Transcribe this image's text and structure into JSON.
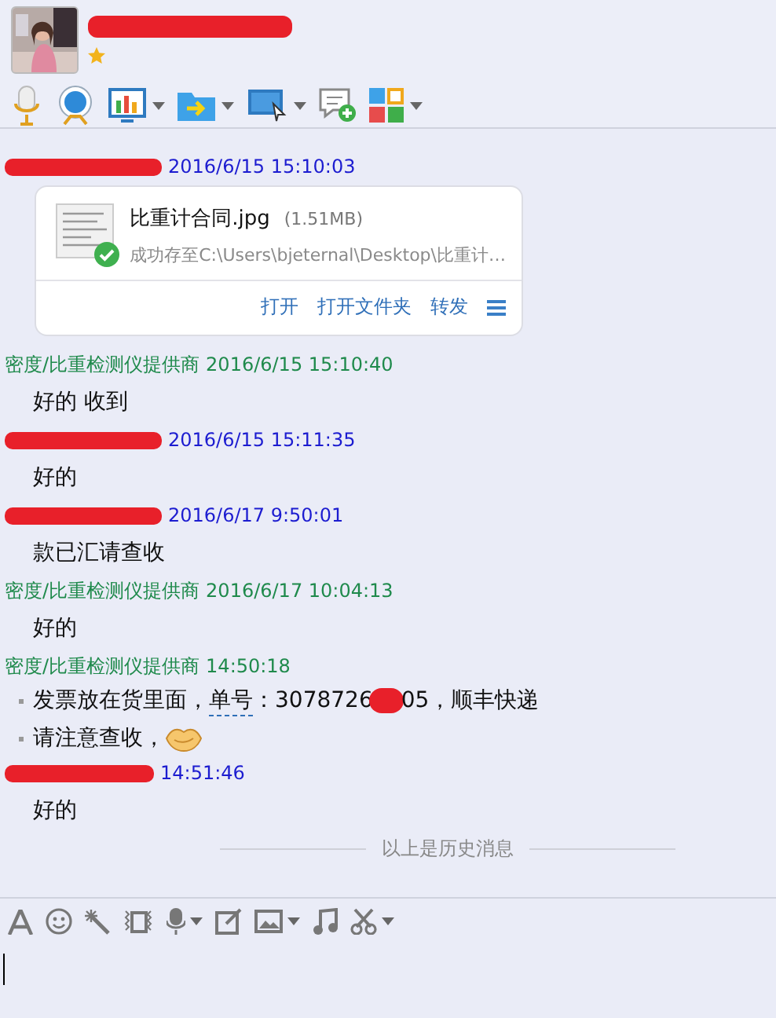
{
  "contact": {
    "name_redacted": true
  },
  "messages": [
    {
      "kind": "file",
      "sender": {
        "redacted": true
      },
      "time": "2016/6/15 15:10:03",
      "color": "#1c1cd0",
      "file": {
        "name": "比重计合同.jpg",
        "size": "(1.51MB)",
        "status": "成功存至C:\\Users\\bjeternal\\Desktop\\比重计…",
        "saved": true,
        "actions": [
          "打开",
          "打开文件夹",
          "转发"
        ]
      }
    },
    {
      "kind": "text",
      "sender": {
        "redacted": false,
        "name": "密度/比重检测仪提供商"
      },
      "time": "2016/6/15 15:10:40",
      "color": "#1f8a4c",
      "text": "好的 收到"
    },
    {
      "kind": "text",
      "sender": {
        "redacted": true
      },
      "time": "2016/6/15 15:11:35",
      "color": "#1c1cd0",
      "text": "好的"
    },
    {
      "kind": "text",
      "sender": {
        "redacted": true
      },
      "time": "2016/6/17 9:50:01",
      "color": "#1c1cd0",
      "text": "款已汇请查收"
    },
    {
      "kind": "text",
      "sender": {
        "redacted": false,
        "name": "密度/比重检测仪提供商"
      },
      "time": "2016/6/17 10:04:13",
      "color": "#1f8a4c",
      "text": "好的"
    },
    {
      "kind": "bullets",
      "sender": {
        "redacted": false,
        "name": "密度/比重检测仪提供商"
      },
      "time": "14:50:18",
      "color": "#1f8a4c",
      "lines": [
        [
          {
            "kind": "text",
            "text": "发票放在货里面，"
          },
          {
            "kind": "link",
            "text": "单号"
          },
          {
            "kind": "text",
            "text": "：3078726"
          },
          {
            "kind": "redaction"
          },
          {
            "kind": "text",
            "text": "05，顺丰快递"
          }
        ],
        [
          {
            "kind": "text",
            "text": "请注意查收，"
          },
          {
            "kind": "emoji"
          }
        ]
      ]
    },
    {
      "kind": "text",
      "sender": {
        "redacted": true
      },
      "time": "14:51:46",
      "color": "#1c1cd0",
      "text": "好的"
    }
  ],
  "history_divider": "以上是历史消息"
}
